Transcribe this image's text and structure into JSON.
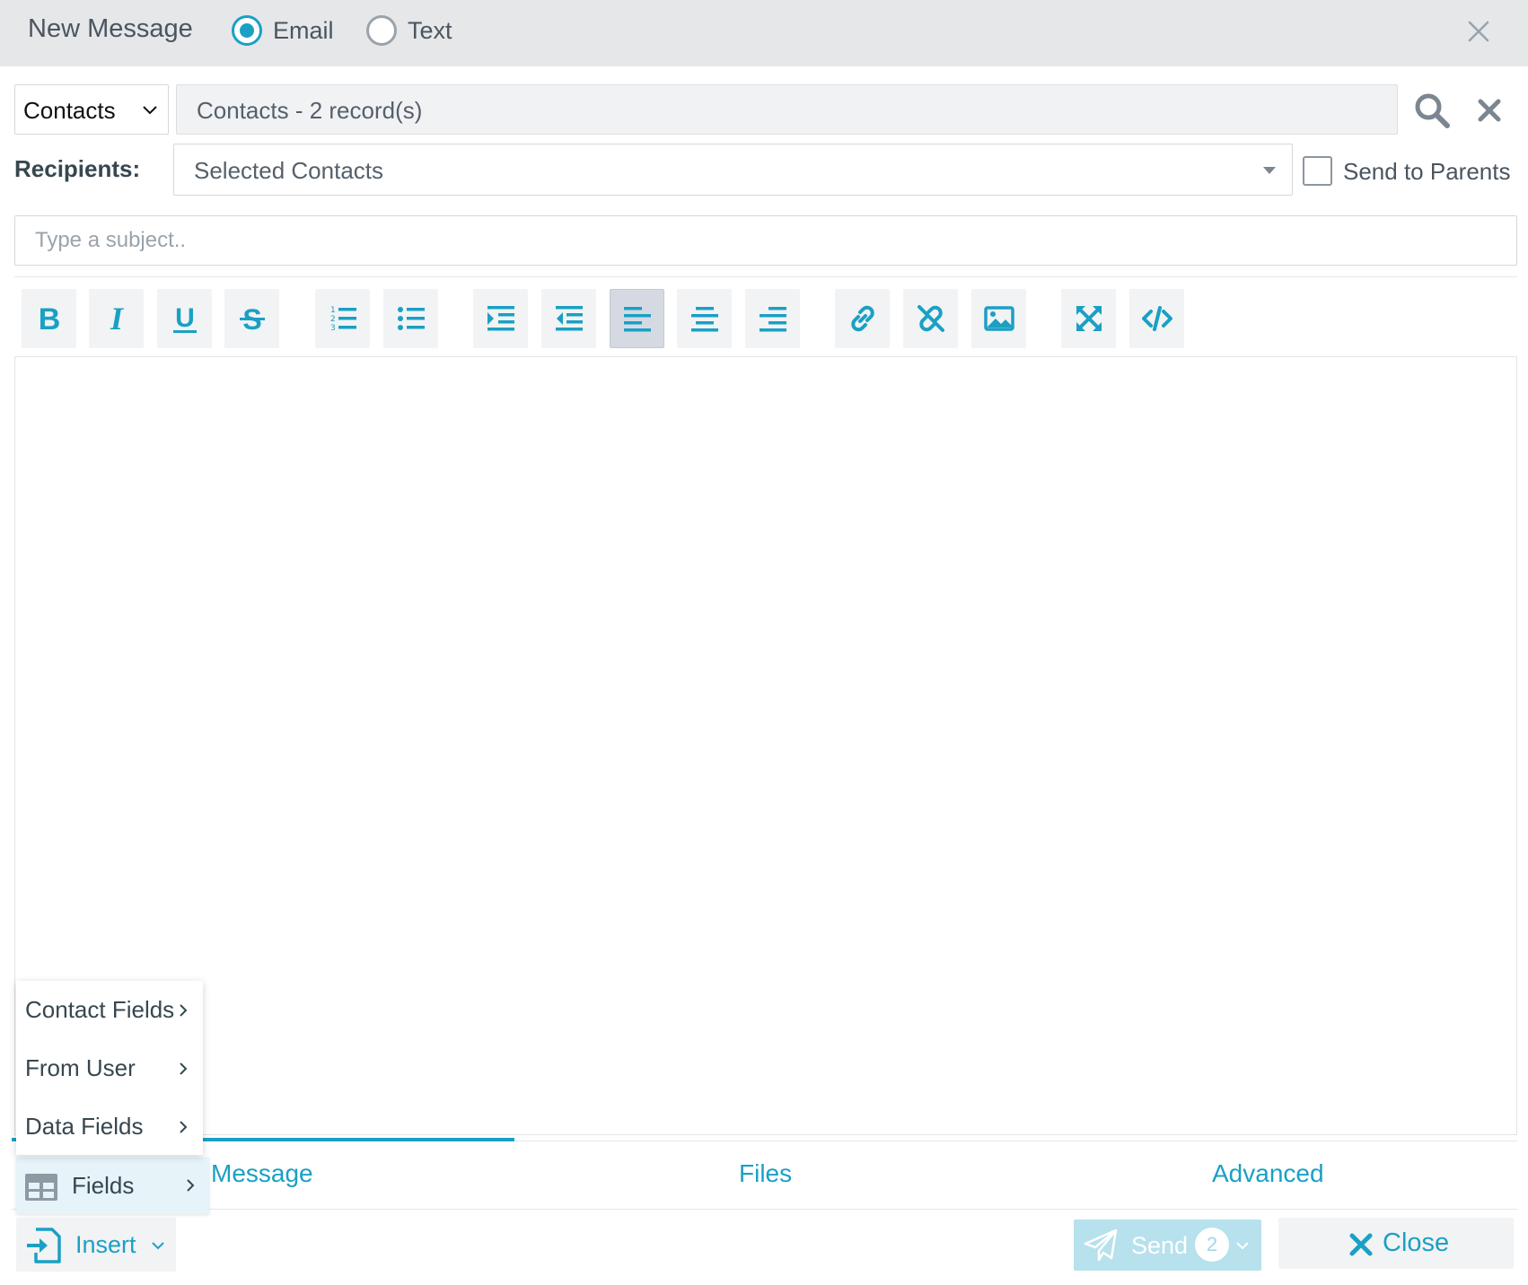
{
  "header": {
    "title": "New Message",
    "mode_options": [
      {
        "label": "Email",
        "selected": true
      },
      {
        "label": "Text",
        "selected": false
      }
    ]
  },
  "source": {
    "selected": "Contacts",
    "records_summary": "Contacts - 2 record(s)"
  },
  "recipients": {
    "label": "Recipients:",
    "value": "Selected Contacts",
    "send_to_parents_label": "Send to Parents",
    "send_to_parents_checked": false
  },
  "subject": {
    "placeholder": "Type a subject..",
    "value": ""
  },
  "toolbar": {
    "buttons": [
      "bold",
      "italic",
      "underline",
      "strikethrough",
      "ordered-list",
      "unordered-list",
      "indent",
      "outdent",
      "align-left",
      "align-center",
      "align-right",
      "link",
      "unlink",
      "image",
      "fullscreen",
      "html-source"
    ],
    "active": "align-left"
  },
  "tabs": [
    {
      "label": "Message",
      "active": true
    },
    {
      "label": "Files",
      "active": false
    },
    {
      "label": "Advanced",
      "active": false
    }
  ],
  "insert_menu": {
    "button_label": "Insert",
    "fields_label": "Fields",
    "submenu": [
      "Contact Fields",
      "From User",
      "Data Fields"
    ]
  },
  "actions": {
    "send_label": "Send",
    "send_count": "2",
    "close_label": "Close"
  },
  "colors": {
    "accent": "#1aa0c5",
    "titlebar": "#e6e7e8",
    "send_disabled": "#b7e1ec"
  }
}
